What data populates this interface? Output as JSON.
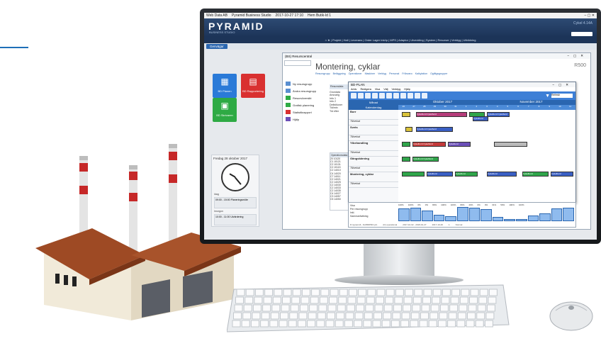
{
  "os_bar": {
    "app1": "Web Data AB",
    "app2": "Pyramid Business Studio",
    "datetime": "2017-10-27 17:10",
    "session": "Hem Butik-Id 1",
    "controls": "–  ▢  ✕"
  },
  "header": {
    "logo": "PYRAMID",
    "logo_sub": "BUSINESS STUDIO",
    "user": "Cykel 4.14A",
    "nav": "⌂  ★  |  Projekt  |  Hall  |  Leverans  |  Order Lager Inköp  |  MPS  |  Adaptor  |  Utveckling  |  System  |  Resurser  |  Verktyg  |  Utbildning"
  },
  "tabs": {
    "active": "Genvägar"
  },
  "tiles": [
    {
      "label": "BD Planen",
      "color": "#2a7ad8"
    },
    {
      "label": "BD Rapportering",
      "color": "#d93030"
    },
    {
      "label": "BD Skrivaren",
      "color": "#2eaa44"
    }
  ],
  "date_widget": {
    "date": "Fredag 28 oktober 2017",
    "event1_label": "Idag",
    "event1": "09:00 - 15:00 Planeringsmöte",
    "event2_label": "Imorgon",
    "event2": "10:00 - 11:00 Utvärdering"
  },
  "resource_window": {
    "title": "(BS) Resurscentral",
    "heading": "Montering, cyklar",
    "code": "R500",
    "tabs": [
      "Resursgrupp",
      "Beläggning",
      "Operationer",
      "Maskiner",
      "Verktyg",
      "Personal",
      "Frånvaro",
      "Kalkylation",
      "Ogiltigsgrupper"
    ],
    "menu": [
      {
        "label": "Ny resursgrupp",
        "color": "#5a8fd0"
      },
      {
        "label": "Ändra resursgrupp",
        "color": "#5a8fd0"
      },
      {
        "label": "Resursöversikt",
        "color": "#2eaa44"
      },
      {
        "label": "Grafisk planering",
        "color": "#2eaa44"
      },
      {
        "label": "Statistikrapport",
        "color": "#d93030"
      },
      {
        "label": "Hjälp",
        "color": "#6b4fb8"
      }
    ],
    "info_header": "Resursdata",
    "info_lines": [
      "Grundata",
      "Ansvarig",
      "Info 1",
      "Info 2",
      "Definitioner",
      "Tid/min",
      "Tid efter"
    ],
    "op_header": "Operationsdata",
    "op_rows": [
      "20  10120",
      "C1  10121",
      "C2  10131",
      "C2  10115",
      "C2  14010",
      "C4  14020",
      "C7  14011",
      "C2  14021",
      "C2  14025",
      "C2  14030",
      "C2  14033",
      "C2  14035",
      "C4  14027",
      "C3  14057",
      "C5  14050"
    ]
  },
  "gantt": {
    "title": "BD-PLAN",
    "menu": [
      "Arkiv",
      "Redigera",
      "Visa",
      "Välj",
      "Verktyg",
      "Hjälp"
    ],
    "filter_value": "Refresh",
    "left_header": "Månad",
    "left_sub": "Kalenderdag",
    "left_sub2": "Tid",
    "months": [
      "Oktober 2017",
      "November 2017"
    ],
    "days": [
      "26",
      "27",
      "28",
      "29",
      "30",
      "31",
      "1",
      "2",
      "3",
      "4",
      "5",
      "6",
      "7",
      "8",
      "9",
      "10",
      "11"
    ],
    "rows": [
      {
        "name": "Borr",
        "sub": "Tillverkat"
      },
      {
        "name": "Svets",
        "sub": "Tillverkat"
      },
      {
        "name": "Ytbehandling",
        "sub": "Tillverkat"
      },
      {
        "name": "Gängskärning",
        "sub": "Tillverkat"
      },
      {
        "name": "Montering, cyklar",
        "sub": "Tillverkat"
      }
    ],
    "bars": [
      {
        "row": 0,
        "start": 0.02,
        "end": 0.06,
        "color": "#d9c23a"
      },
      {
        "row": 0,
        "start": 0.1,
        "end": 0.38,
        "color": "#b53c7a",
        "label": "Cykelbord Cykelbord"
      },
      {
        "row": 0,
        "start": 0.4,
        "end": 0.48,
        "color": "#2fa54a"
      },
      {
        "row": 0,
        "start": 0.5,
        "end": 0.62,
        "color": "#3a5fc4",
        "label": "Cykelbord Cykelbord"
      },
      {
        "row": 0,
        "start": 0.42,
        "end": 0.5,
        "color": "#3a5fc4",
        "label": "Cykelbord",
        "lane": 1
      },
      {
        "row": 1,
        "start": 0.04,
        "end": 0.07,
        "color": "#d9c23a"
      },
      {
        "row": 1,
        "start": 0.1,
        "end": 0.3,
        "color": "#3a5fc4",
        "label": "Cykelbord Cykelbord"
      },
      {
        "row": 2,
        "start": 0.02,
        "end": 0.06,
        "color": "#2fa54a"
      },
      {
        "row": 2,
        "start": 0.08,
        "end": 0.26,
        "color": "#c43a3a",
        "label": "Cykelbord Cykelbord"
      },
      {
        "row": 2,
        "start": 0.28,
        "end": 0.4,
        "color": "#6b4fb8",
        "label": "Cykelbord"
      },
      {
        "row": 2,
        "start": 0.54,
        "end": 0.72,
        "color": "#bbbbbb"
      },
      {
        "row": 3,
        "start": 0.02,
        "end": 0.06,
        "color": "#2fa54a"
      },
      {
        "row": 3,
        "start": 0.08,
        "end": 0.22,
        "color": "#2fa54a",
        "label": "Cykelbord Cykelbord"
      },
      {
        "row": 4,
        "start": 0.02,
        "end": 0.14,
        "color": "#2fa54a"
      },
      {
        "row": 4,
        "start": 0.16,
        "end": 0.3,
        "color": "#3a5fc4",
        "label": "Cykelbord"
      },
      {
        "row": 4,
        "start": 0.32,
        "end": 0.44,
        "color": "#2fa54a",
        "label": "Cykelbord"
      },
      {
        "row": 4,
        "start": 0.5,
        "end": 0.66,
        "color": "#3a5fc4",
        "label": "Cykelbord"
      },
      {
        "row": 4,
        "start": 0.7,
        "end": 0.84,
        "color": "#2fa54a",
        "label": "Cykelbord"
      },
      {
        "row": 4,
        "start": 0.86,
        "end": 0.98,
        "color": "#3a5fc4",
        "label": "Cykelbord"
      }
    ]
  },
  "overview": {
    "left_lines": [
      "Visa",
      "Per resursgrupp",
      "Inkl.",
      "Sammanfattning"
    ],
    "stats": [
      "100%",
      "100%",
      "0%",
      "0%",
      "80%",
      "100%",
      "100%",
      "80%",
      "20%",
      "0%",
      "0%",
      "31%",
      "50%",
      "100%",
      "100%"
    ],
    "bars": [
      90,
      95,
      70,
      40,
      30,
      100,
      95,
      85,
      25,
      5,
      5,
      35,
      50,
      90,
      95
    ],
    "status": [
      "D:\\pyramid\\...\\bd\\BDPRO.pln",
      "(D) operational",
      "2017-10-02 - 2018-01-27",
      "2017-10-26",
      "1",
      "Normal"
    ]
  }
}
